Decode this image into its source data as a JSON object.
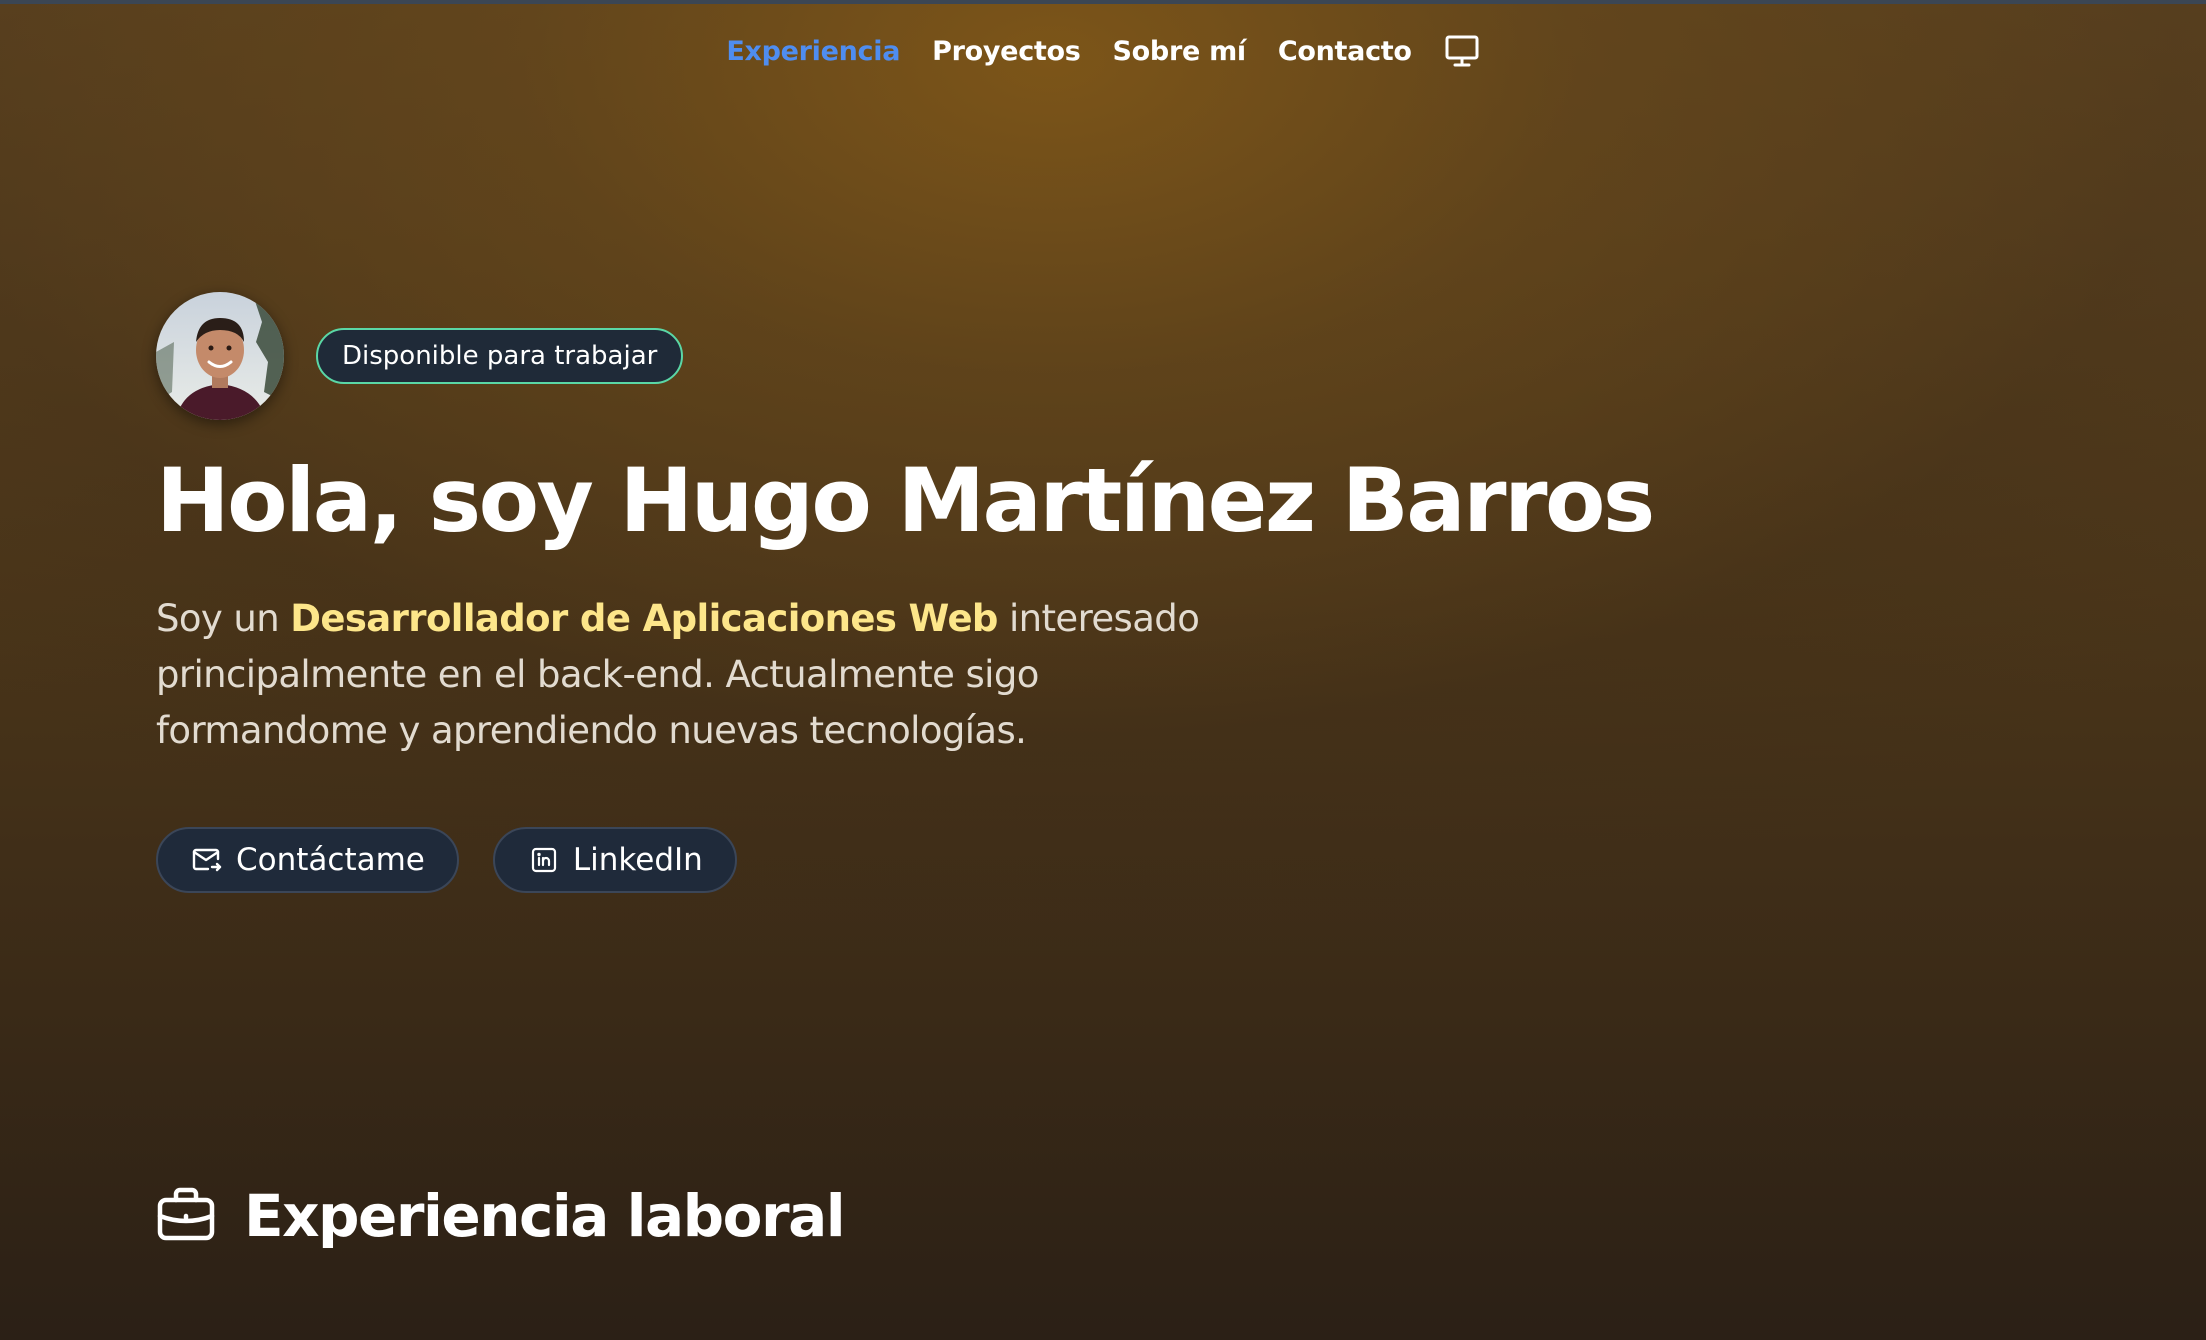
{
  "nav": {
    "items": [
      {
        "label": "Experiencia",
        "active": true
      },
      {
        "label": "Proyectos",
        "active": false
      },
      {
        "label": "Sobre mí",
        "active": false
      },
      {
        "label": "Contacto",
        "active": false
      }
    ],
    "theme_icon": "monitor-icon"
  },
  "hero": {
    "avatar": "avatar-photo",
    "badge": "Disponible para trabajar",
    "title": "Hola, soy Hugo Martínez Barros",
    "description": {
      "prefix": "Soy un ",
      "highlight": "Desarrollador de Aplicaciones Web",
      "suffix": " interesado principalmente en el back-end. Actualmente sigo formandome y aprendiendo nuevas tecnologías."
    },
    "buttons": [
      {
        "label": "Contáctame",
        "icon": "mail-icon"
      },
      {
        "label": "LinkedIn",
        "icon": "linkedin-icon"
      }
    ]
  },
  "sections": {
    "experience": {
      "title": "Experiencia laboral",
      "icon": "briefcase-icon"
    }
  },
  "colors": {
    "accent_nav": "#4f8df0",
    "highlight": "#fde68a",
    "badge_border": "#5ad7a6",
    "button_bg": "#1f2a3a"
  }
}
